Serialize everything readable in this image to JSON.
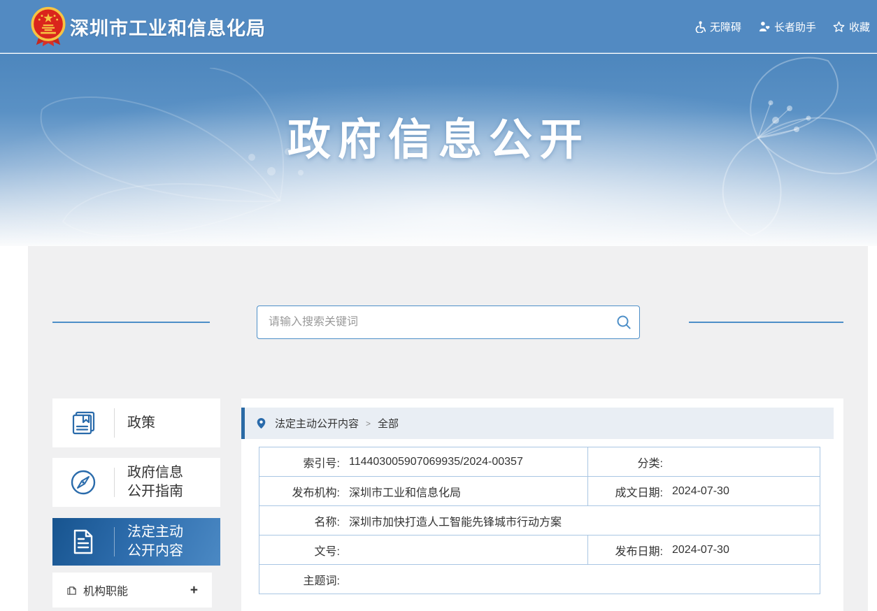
{
  "colors": {
    "header_bg": "#528ac2",
    "accent_blue": "#2a6bab",
    "search_border": "#4d8fc8",
    "active_item_gradient_start": "#17548f",
    "active_item_gradient_end": "#4b89c4",
    "breadcrumb_bar": "#2a6aa5",
    "breadcrumb_bg": "#e9eef4",
    "table_border": "#a9c6e3",
    "card_bg": "#f0f0f1"
  },
  "header": {
    "site_title": "深圳市工业和信息化局",
    "links": [
      {
        "label": "无障碍",
        "icon": "accessibility-icon"
      },
      {
        "label": "长者助手",
        "icon": "elder-assist-icon"
      },
      {
        "label": "收藏",
        "icon": "star-icon"
      }
    ]
  },
  "banner": {
    "title": "政府信息公开"
  },
  "search": {
    "placeholder": "请输入搜索关键词",
    "icon": "search-icon"
  },
  "sidebar": {
    "items": [
      {
        "line1": "政策",
        "line2": "",
        "icon": "book-icon",
        "active": false
      },
      {
        "line1": "政府信息",
        "line2": "公开指南",
        "icon": "compass-icon",
        "active": false
      },
      {
        "line1": "法定主动",
        "line2": "公开内容",
        "icon": "document-icon",
        "active": true
      }
    ],
    "submenu": {
      "label": "机构职能",
      "expand_symbol": "+",
      "icon": "page-icon"
    }
  },
  "breadcrumb": {
    "icon": "location-pin-icon",
    "root": "法定主动公开内容",
    "separator": ">",
    "current": "全部"
  },
  "detail_table": {
    "rows": [
      {
        "left_label": "索引号:",
        "left_value": "114403005907069935/2024-00357",
        "right_label": "分类:",
        "right_value": ""
      },
      {
        "left_label": "发布机构:",
        "left_value": "深圳市工业和信息化局",
        "right_label": "成文日期:",
        "right_value": "2024-07-30"
      },
      {
        "full_label": "名称:",
        "full_value": "深圳市加快打造人工智能先锋城市行动方案"
      },
      {
        "left_label": "文号:",
        "left_value": "",
        "right_label": "发布日期:",
        "right_value": "2024-07-30"
      },
      {
        "full_label": "主题词:",
        "full_value": ""
      }
    ]
  }
}
